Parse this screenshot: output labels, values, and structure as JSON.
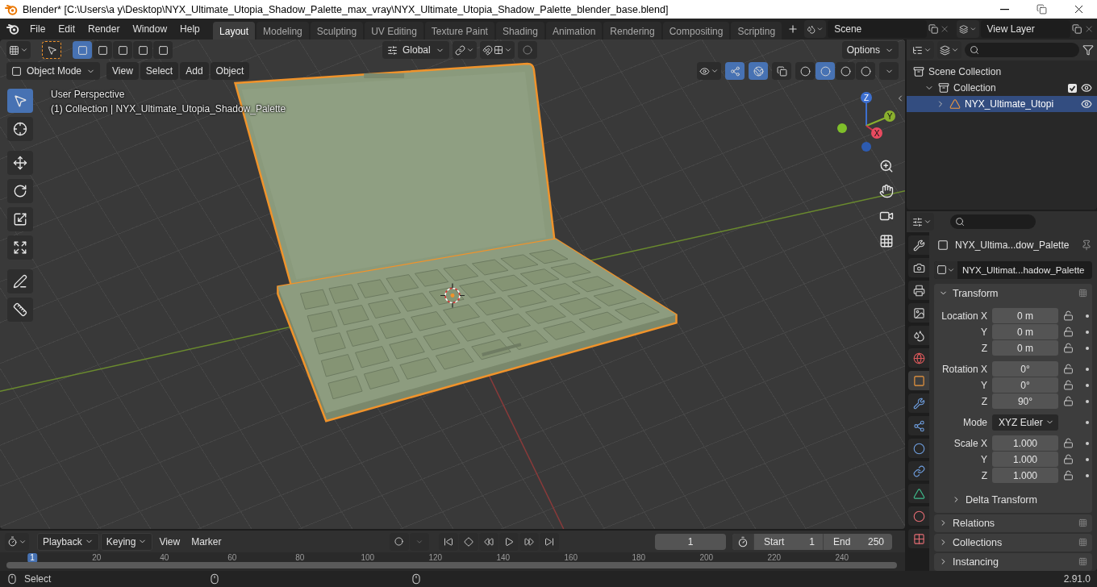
{
  "window": {
    "title": "Blender* [C:\\Users\\a y\\Desktop\\NYX_Ultimate_Utopia_Shadow_Palette_max_vray\\NYX_Ultimate_Utopia_Shadow_Palette_blender_base.blend]"
  },
  "menu": [
    "File",
    "Edit",
    "Render",
    "Window",
    "Help"
  ],
  "workspaces": [
    {
      "label": "Layout",
      "selected": true
    },
    {
      "label": "Modeling",
      "selected": false
    },
    {
      "label": "Sculpting",
      "selected": false
    },
    {
      "label": "UV Editing",
      "selected": false
    },
    {
      "label": "Texture Paint",
      "selected": false
    },
    {
      "label": "Shading",
      "selected": false
    },
    {
      "label": "Animation",
      "selected": false
    },
    {
      "label": "Rendering",
      "selected": false
    },
    {
      "label": "Compositing",
      "selected": false
    },
    {
      "label": "Scripting",
      "selected": false
    }
  ],
  "scene": {
    "value": "Scene"
  },
  "view_layer": {
    "value": "View Layer"
  },
  "viewport": {
    "select_modes": [
      {
        "selected": true
      },
      {
        "selected": false
      },
      {
        "selected": false
      },
      {
        "selected": false
      },
      {
        "selected": false
      }
    ],
    "orientation": "Global",
    "options": "Options",
    "mode": "Object Mode",
    "menus": [
      "View",
      "Select",
      "Add",
      "Object"
    ],
    "shading_modes": [
      {
        "selected": false
      },
      {
        "selected": true
      },
      {
        "selected": false
      },
      {
        "selected": false
      }
    ],
    "perspective": "User Perspective",
    "object_info": "(1) Collection | NYX_Ultimate_Utopia_Shadow_Palette",
    "gizmo_axes": [
      "X",
      "Y",
      "Z"
    ],
    "tools": [
      {
        "kind": "select",
        "selected": true
      },
      {
        "kind": "cursor",
        "selected": false
      },
      {
        "kind": "move",
        "selected": false
      },
      {
        "kind": "rotate",
        "selected": false
      },
      {
        "kind": "scale",
        "selected": false
      },
      {
        "kind": "transform",
        "selected": false
      },
      {
        "kind": "annotate",
        "selected": false
      },
      {
        "kind": "measure",
        "selected": false
      }
    ]
  },
  "outliner": {
    "items": [
      {
        "label": "Scene Collection",
        "kind": "scene",
        "selected": false,
        "children": [
          {
            "label": "Collection",
            "kind": "collection",
            "selected": false,
            "expanded": true,
            "checked": true,
            "visible": true,
            "children": [
              {
                "label": "NYX_Ultimate_Utopi",
                "kind": "object",
                "selected": true,
                "expanded": false,
                "visible": true
              }
            ]
          }
        ]
      }
    ]
  },
  "properties": {
    "tabs": [
      {
        "kind": "tool",
        "selected": false
      },
      {
        "kind": "render",
        "selected": false
      },
      {
        "kind": "output",
        "selected": false
      },
      {
        "kind": "view_layer",
        "selected": false
      },
      {
        "kind": "scene",
        "selected": false
      },
      {
        "kind": "world",
        "selected": false
      },
      {
        "kind": "object",
        "selected": true
      },
      {
        "kind": "modifiers",
        "selected": false
      },
      {
        "kind": "particles",
        "selected": false
      },
      {
        "kind": "physics",
        "selected": false
      },
      {
        "kind": "constraints",
        "selected": false
      },
      {
        "kind": "data",
        "selected": false
      },
      {
        "kind": "material",
        "selected": false
      },
      {
        "kind": "texture",
        "selected": false
      }
    ],
    "object_name": "NYX_Ultima...dow_Palette",
    "data_name": "NYX_Ultimat...hadow_Palette",
    "panel": {
      "title": "Transform",
      "expanded": true,
      "groups": [
        {
          "rows": [
            {
              "label": "Location X",
              "value": "0 m",
              "kind": "number"
            },
            {
              "label": "Y",
              "value": "0 m",
              "kind": "number"
            },
            {
              "label": "Z",
              "value": "0 m",
              "kind": "number"
            }
          ]
        },
        {
          "rows": [
            {
              "label": "Rotation X",
              "value": "0°",
              "kind": "number"
            },
            {
              "label": "Y",
              "value": "0°",
              "kind": "number"
            },
            {
              "label": "Z",
              "value": "90°",
              "kind": "number"
            }
          ]
        },
        {
          "rows": [
            {
              "label": "Mode",
              "value": "XYZ Euler",
              "kind": "dropdown"
            }
          ]
        },
        {
          "rows": [
            {
              "label": "Scale X",
              "value": "1.000",
              "kind": "number"
            },
            {
              "label": "Y",
              "value": "1.000",
              "kind": "number"
            },
            {
              "label": "Z",
              "value": "1.000",
              "kind": "number"
            }
          ]
        }
      ]
    },
    "sections": [
      {
        "title": "Delta Transform",
        "kind": "subpanel",
        "expanded": false
      },
      {
        "title": "Relations",
        "kind": "panel",
        "expanded": false
      },
      {
        "title": "Collections",
        "kind": "panel",
        "expanded": false
      },
      {
        "title": "Instancing",
        "kind": "panel",
        "expanded": false
      }
    ]
  },
  "timeline": {
    "menus": [
      {
        "label": "Playback",
        "kind": "dropdown"
      },
      {
        "label": "Keying",
        "kind": "dropdown"
      },
      {
        "label": "View",
        "kind": "plain"
      },
      {
        "label": "Marker",
        "kind": "plain"
      }
    ],
    "current_frame": "1",
    "start_label": "Start",
    "start": "1",
    "end_label": "End",
    "end": "250",
    "ruler": [
      {
        "label": "1",
        "selected": true
      },
      {
        "label": "20",
        "selected": false
      },
      {
        "label": "40",
        "selected": false
      },
      {
        "label": "60",
        "selected": false
      },
      {
        "label": "80",
        "selected": false
      },
      {
        "label": "100",
        "selected": false
      },
      {
        "label": "120",
        "selected": false
      },
      {
        "label": "140",
        "selected": false
      },
      {
        "label": "160",
        "selected": false
      },
      {
        "label": "180",
        "selected": false
      },
      {
        "label": "200",
        "selected": false
      },
      {
        "label": "220",
        "selected": false
      },
      {
        "label": "240",
        "selected": false
      }
    ]
  },
  "status_bar": {
    "action": "Select",
    "version": "2.91.0"
  }
}
